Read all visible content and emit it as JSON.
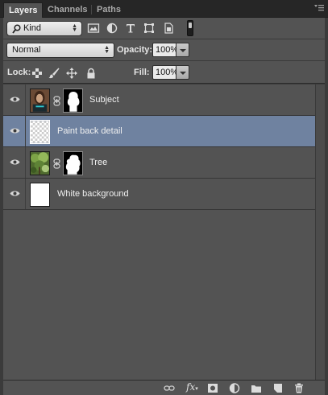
{
  "tabs": [
    {
      "label": "Layers",
      "active": true
    },
    {
      "label": "Channels",
      "active": false
    },
    {
      "label": "Paths",
      "active": false
    }
  ],
  "filter": {
    "kind_label": "Kind",
    "icons": [
      "image-filter-icon",
      "adjustment-filter-icon",
      "type-filter-icon",
      "shape-filter-icon",
      "smart-object-filter-icon"
    ]
  },
  "blend": {
    "mode": "Normal",
    "opacity_label": "Opacity:",
    "opacity_value": "100%"
  },
  "lock": {
    "label": "Lock:",
    "fill_label": "Fill:",
    "fill_value": "100%"
  },
  "layers": [
    {
      "name": "Subject",
      "selected": false,
      "has_mask": true,
      "thumb": "photo-person"
    },
    {
      "name": "Paint back detail",
      "selected": true,
      "has_mask": false,
      "thumb": "transparent"
    },
    {
      "name": "Tree",
      "selected": false,
      "has_mask": true,
      "thumb": "photo-tree"
    },
    {
      "name": "White background",
      "selected": false,
      "has_mask": false,
      "thumb": "white"
    }
  ],
  "footer_icons": [
    "link-layers-icon",
    "fx-icon",
    "add-mask-icon",
    "adjustment-layer-icon",
    "new-group-icon",
    "new-layer-icon",
    "trash-icon"
  ],
  "colors": {
    "panel": "#535353",
    "selected_row": "#6f82a0",
    "tabbar": "#262626"
  }
}
